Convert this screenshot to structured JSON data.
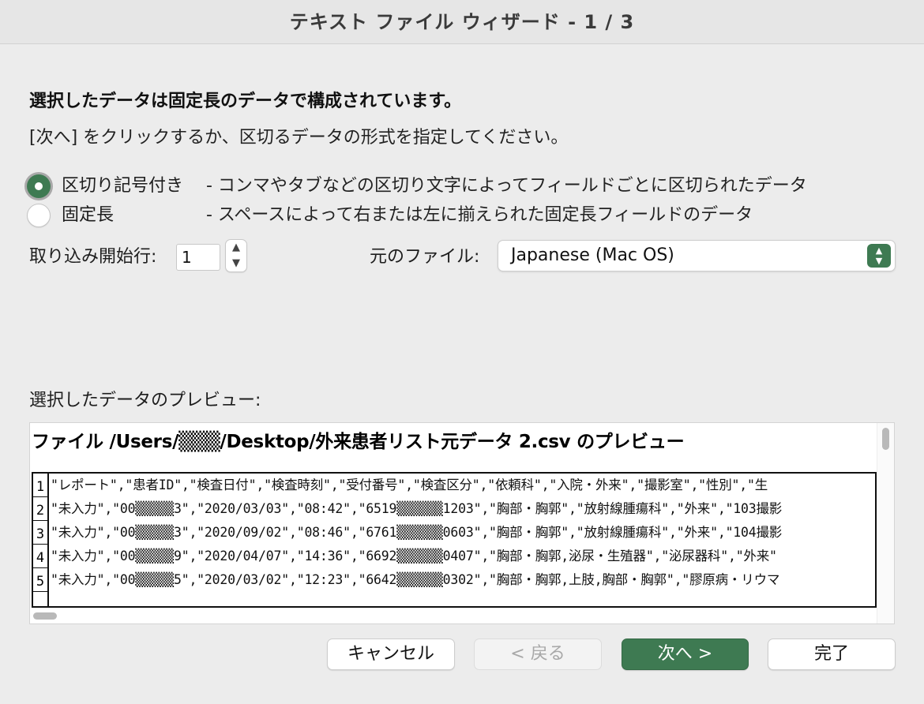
{
  "window": {
    "title": "テキスト ファイル ウィザード - 1 / 3"
  },
  "instructions": {
    "heading": "選択したデータは固定長のデータで構成されています。",
    "subheading": "[次へ] をクリックするか、区切るデータの形式を指定してください。"
  },
  "data_type": {
    "options": [
      {
        "label": "区切り記号付き",
        "description": "- コンマやタブなどの区切り文字によってフィールドごとに区切られたデータ",
        "selected": true
      },
      {
        "label": "固定長",
        "description": "- スペースによって右または左に揃えられた固定長フィールドのデータ",
        "selected": false
      }
    ]
  },
  "start_row": {
    "label": "取り込み開始行:",
    "value": "1"
  },
  "file_origin": {
    "label": "元のファイル:",
    "value": "Japanese (Mac OS)"
  },
  "preview": {
    "label": "選択したデータのプレビュー:",
    "title": "ファイル /Users/▒▒▒/Desktop/外来患者リスト元データ 2.csv のプレビュー",
    "rows": [
      {
        "num": "1",
        "text": "\"レポート\",\"患者ID\",\"検査日付\",\"検査時刻\",\"受付番号\",\"検査区分\",\"依頼科\",\"入院・外来\",\"撮影室\",\"性別\",\"生"
      },
      {
        "num": "2",
        "text": "\"未入力\",\"00▒▒▒▒▒3\",\"2020/03/03\",\"08:42\",\"6519▒▒▒▒▒▒1203\",\"胸部・胸郭\",\"放射線腫瘍科\",\"外来\",\"103撮影"
      },
      {
        "num": "3",
        "text": "\"未入力\",\"00▒▒▒▒▒3\",\"2020/09/02\",\"08:46\",\"6761▒▒▒▒▒▒0603\",\"胸部・胸郭\",\"放射線腫瘍科\",\"外来\",\"104撮影"
      },
      {
        "num": "4",
        "text": "\"未入力\",\"00▒▒▒▒▒9\",\"2020/04/07\",\"14:36\",\"6692▒▒▒▒▒▒0407\",\"胸部・胸郭,泌尿・生殖器\",\"泌尿器科\",\"外来\""
      },
      {
        "num": "5",
        "text": "\"未入力\",\"00▒▒▒▒▒5\",\"2020/03/02\",\"12:23\",\"6642▒▒▒▒▒▒0302\",\"胸部・胸郭,上肢,胸部・胸郭\",\"膠原病・リウマ"
      }
    ]
  },
  "buttons": {
    "cancel": "キャンセル",
    "back": "< 戻る",
    "next": "次へ >",
    "finish": "完了"
  },
  "colors": {
    "accent": "#3e7a52"
  }
}
